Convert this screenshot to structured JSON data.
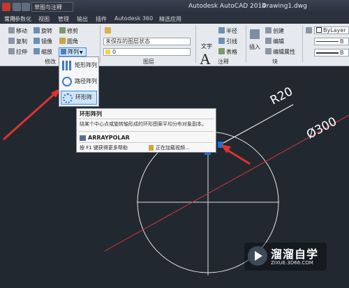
{
  "titlebar": {
    "workspace": "草图与注释",
    "app_title": "Autodesk AutoCAD 2014",
    "doc_title": "Drawing1.dwg"
  },
  "tabs": [
    "常用",
    "参数化",
    "视图",
    "管理",
    "输出",
    "插件",
    "Autodesk 360",
    "精选应用"
  ],
  "ribbon": {
    "modify": {
      "move": "移动",
      "rotate": "旋转",
      "trim": "修剪",
      "copy": "复制",
      "mirror": "镜像",
      "fillet": "圆角",
      "stretch": "拉伸",
      "scale": "缩放",
      "array": "阵列",
      "label": "修改"
    },
    "layers": {
      "state": "未保存的图层状态",
      "current": "0",
      "label": "图层"
    },
    "annotation": {
      "text": "文字",
      "radius": "半径",
      "leader": "引线",
      "table": "表格",
      "label": "注释"
    },
    "block": {
      "insert": "插入",
      "create": "创建",
      "edit": "编辑",
      "edit_attr": "编辑属性",
      "label": "块"
    },
    "properties": {
      "bylayer": "ByLayer",
      "b1": "B",
      "b2": "B"
    }
  },
  "array_menu": {
    "items": [
      {
        "label": "矩形阵列"
      },
      {
        "label": "路径阵列"
      },
      {
        "label": "环形阵列"
      }
    ]
  },
  "tooltip": {
    "title": "环形阵列",
    "description": "绕某个中心点或旋转轴形成的环形图案平均分布对象副本。",
    "command": "ARRAYPOLAR",
    "help": "按 F1 键获得更多帮助",
    "video": "正在加载视频..."
  },
  "drawing": {
    "radius_label": "R20",
    "diameter_label": "Ø300"
  },
  "watermark": {
    "title": "溜溜自学",
    "url": "ZIXUE.3D66.COM"
  },
  "colors": {
    "canvas": "#212830",
    "ribbon": "#e6e9ed",
    "highlight": "#cfe4fa",
    "arrow": "#e0322e",
    "grip": "#1a6fe0"
  }
}
